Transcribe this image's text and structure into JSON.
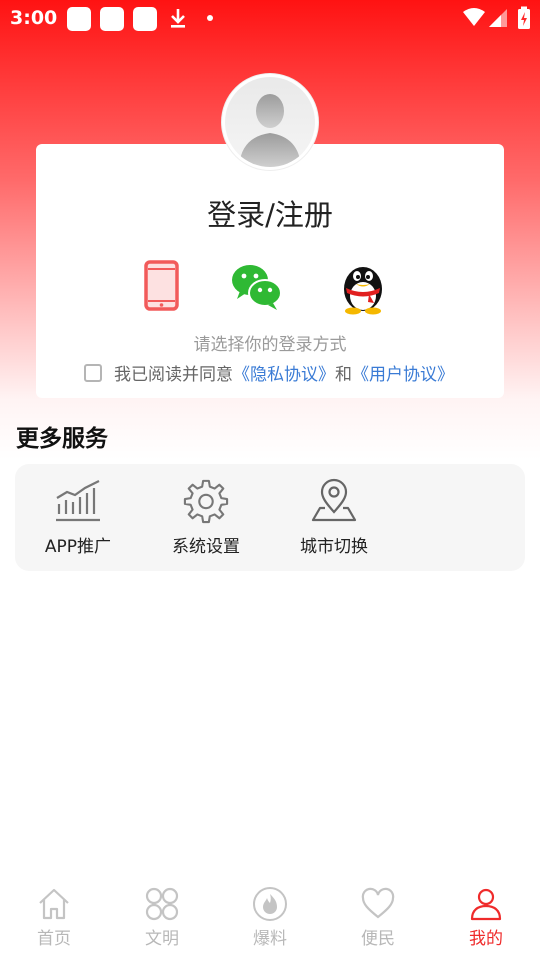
{
  "status_bar": {
    "time": "3:00"
  },
  "login": {
    "title": "登录/注册",
    "hint": "请选择你的登录方式",
    "methods": [
      {
        "name": "phone",
        "icon": "phone-icon",
        "color": "#f25b5b"
      },
      {
        "name": "wechat",
        "icon": "wechat-icon",
        "color": "#2fb934"
      },
      {
        "name": "qq",
        "icon": "qq-penguin-icon",
        "color": "#111111"
      }
    ],
    "agreement": {
      "prefix": "我已阅读并同意",
      "privacy": "《隐私协议》",
      "and": "和",
      "user": "《用户协议》",
      "checked": false
    }
  },
  "services": {
    "title": "更多服务",
    "items": [
      {
        "label": "APP推广",
        "icon": "bar-chart-icon"
      },
      {
        "label": "系统设置",
        "icon": "gear-icon"
      },
      {
        "label": "城市切换",
        "icon": "location-pin-icon"
      }
    ]
  },
  "tab_bar": {
    "items": [
      {
        "label": "首页",
        "icon": "home-icon",
        "active": false
      },
      {
        "label": "文明",
        "icon": "grid-icon",
        "active": false
      },
      {
        "label": "爆料",
        "icon": "flame-icon",
        "active": false
      },
      {
        "label": "便民",
        "icon": "heart-icon",
        "active": false
      },
      {
        "label": "我的",
        "icon": "person-icon",
        "active": true
      }
    ]
  },
  "colors": {
    "accent": "#ef2b2b",
    "link": "#3a7bd5",
    "inactive": "#b8b8b8"
  }
}
